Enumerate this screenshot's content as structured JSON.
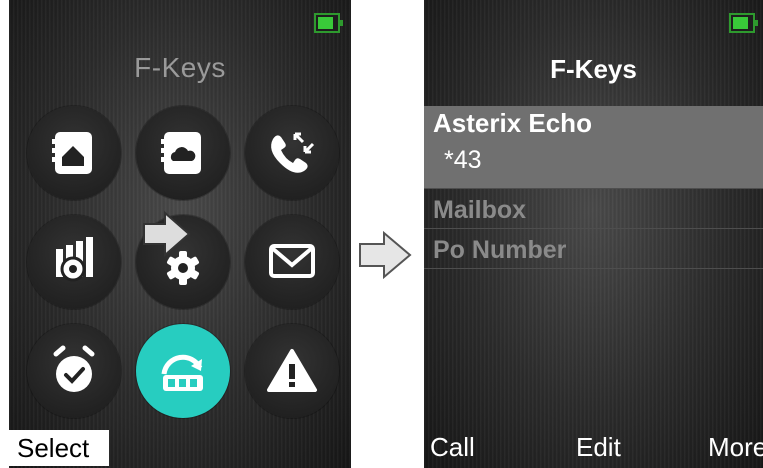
{
  "left_screen": {
    "title": "F-Keys",
    "softkey_left": "Select",
    "battery": "battery-full-icon",
    "icons": [
      "contacts-home-icon",
      "contacts-cloud-icon",
      "call-log-icon",
      "settings-grid-icon",
      "settings-gear-icon",
      "messages-icon",
      "alarm-icon",
      "f-keys-icon",
      "alert-icon"
    ],
    "active_icon": "f-keys-icon"
  },
  "right_screen": {
    "title": "F-Keys",
    "battery": "battery-full-icon",
    "list": [
      {
        "name": "Asterix Echo",
        "number": "*43",
        "selected": true
      },
      {
        "name": "Mailbox",
        "selected": false
      },
      {
        "name": "Po Number",
        "selected": false
      }
    ],
    "softkeys": {
      "left": "Call",
      "center": "Edit",
      "right": "More"
    }
  },
  "colors": {
    "accent": "#27cdc0",
    "battery": "#39c939",
    "selection": "#707070"
  }
}
